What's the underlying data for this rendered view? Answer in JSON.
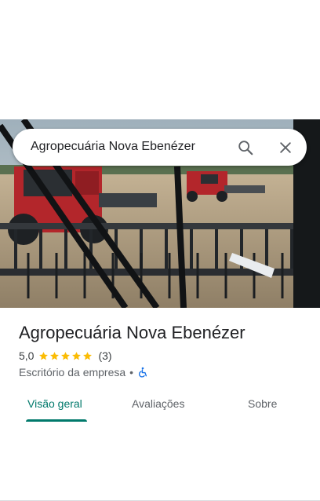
{
  "search": {
    "query": "Agropecuária Nova Ebenézer"
  },
  "icons": {
    "search": "search-icon",
    "close": "close-icon",
    "star": "star-icon",
    "accessibility": "wheelchair-icon"
  },
  "place": {
    "name": "Agropecuária Nova Ebenézer",
    "rating": "5,0",
    "stars": 5,
    "review_count": "(3)",
    "category": "Escritório da empresa",
    "separator": "•"
  },
  "tabs": [
    {
      "label": "Visão geral",
      "active": true
    },
    {
      "label": "Avaliações",
      "active": false
    },
    {
      "label": "Sobre",
      "active": false
    }
  ],
  "colors": {
    "accent": "#00796b",
    "star": "#fbbc04",
    "accessibility": "#1a73e8",
    "machine_red": "#b3262b"
  }
}
